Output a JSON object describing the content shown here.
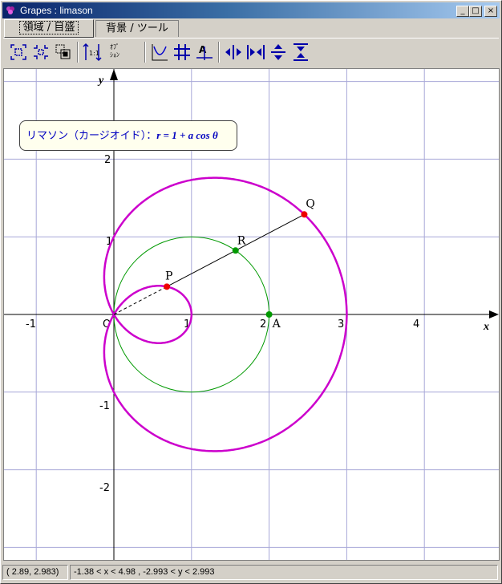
{
  "window": {
    "title": "Grapes : limason",
    "buttons": {
      "minimize": "_",
      "maximize": "□",
      "close": "×"
    }
  },
  "tabs": [
    {
      "label": "領域 / 目盛",
      "active": true
    },
    {
      "label": "背景 / ツール",
      "active": false
    }
  ],
  "toolbar": {
    "option_label_line1": "ｵﾌﾟ",
    "option_label_line2": "ｼｮﾝ",
    "icons": [
      "fit-view-icon",
      "shrink-view-icon",
      "zoom-box-icon",
      "aspect-1to1-icon",
      "options-icon",
      "graph-icon",
      "grid-icon",
      "axis-label-icon",
      "x-stretch-icon",
      "x-shrink-icon",
      "y-stretch-icon",
      "y-shrink-icon"
    ]
  },
  "graph": {
    "axis": {
      "x_label": "x",
      "y_label": "y",
      "origin_label": "O"
    },
    "x_ticks": [
      "-1",
      "1",
      "2",
      "3",
      "4"
    ],
    "y_ticks": [
      "2",
      "1",
      "-1",
      "-2"
    ],
    "points": {
      "P": "P",
      "Q": "Q",
      "R": "R",
      "A": "A"
    },
    "label_box": {
      "text_jp": "リマソン（カージオイド）：",
      "equation": "r = 1 + a cos θ"
    },
    "colors": {
      "curve": "#cc00cc",
      "circle": "#009900",
      "grid": "#a8a8d8",
      "point_red": "#ee0000",
      "point_green": "#009900"
    },
    "param_a": 2
  },
  "status": {
    "coords": "( 2.89, 2.983)",
    "range": "-1.38 < x < 4.98 , -2.993 < y < 2.993"
  }
}
